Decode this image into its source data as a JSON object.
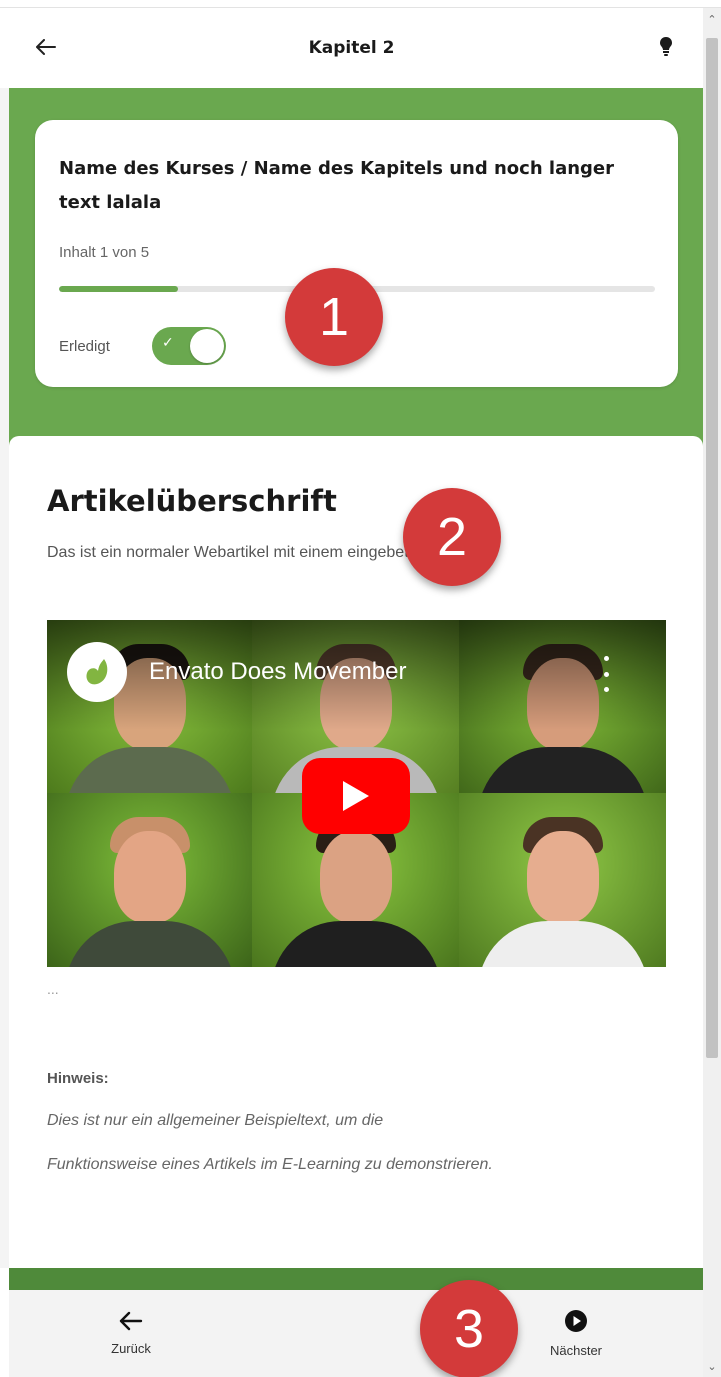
{
  "header": {
    "title": "Kapitel 2"
  },
  "course": {
    "title": "Name des Kurses / Name des Kapitels und noch langer text lalala",
    "progress_text": "Inhalt 1 von 5",
    "progress_fraction": 0.2,
    "done_label": "Erledigt",
    "done_checked": true
  },
  "article": {
    "heading": "Artikelüberschrift",
    "lead": "Das ist ein normaler Webartikel mit einem eingebetteten Video.",
    "ellipsis": "...",
    "note_label": "Hinweis:",
    "note_lines": [
      "Dies ist nur ein allgemeiner Beispieltext, um die",
      "Funktionsweise eines Artikels im E-Learning zu demonstrieren."
    ]
  },
  "video": {
    "title": "Envato Does Movember",
    "channel_icon": "envato-leaf-icon",
    "play_icon": "youtube-play-icon"
  },
  "bottom_nav": {
    "back_label": "Zurück",
    "next_label": "Nächster"
  },
  "markers": [
    "1",
    "2",
    "3"
  ],
  "colors": {
    "accent_green": "#6aa84f",
    "dark_green": "#4f8a3a",
    "marker_red": "#d33a3a",
    "youtube_red": "#ff0000"
  }
}
